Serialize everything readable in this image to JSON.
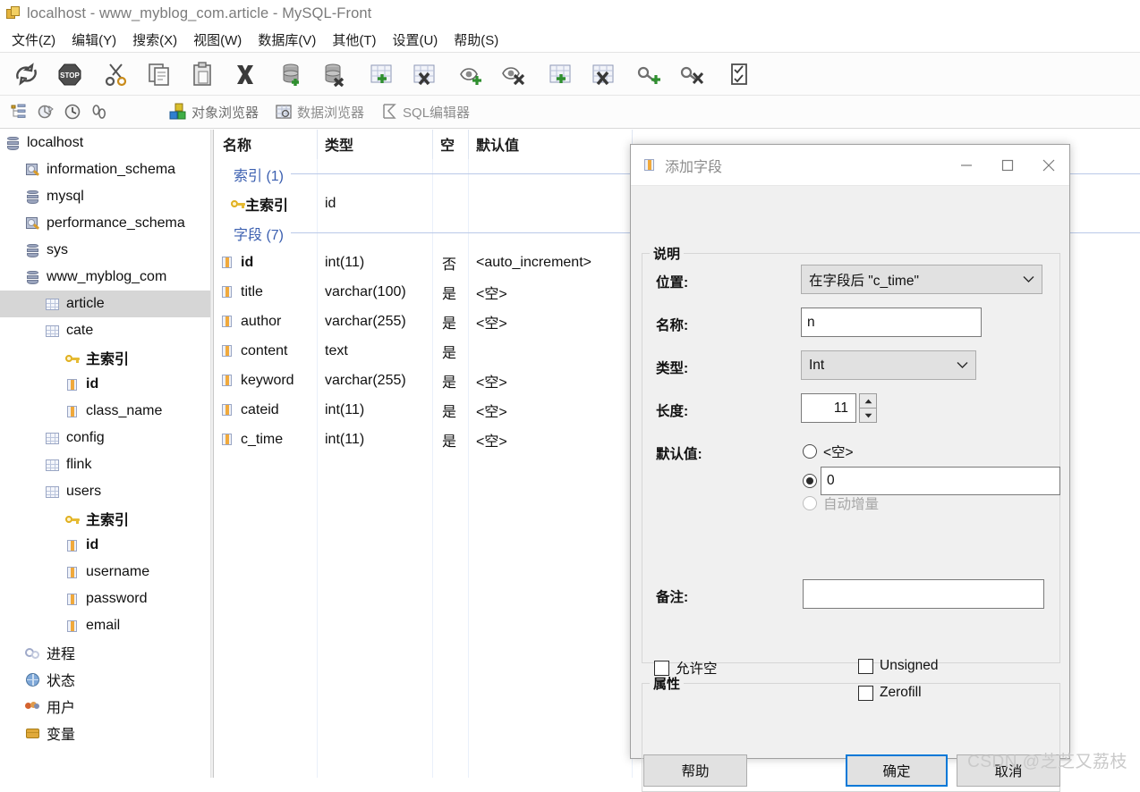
{
  "window": {
    "title": "localhost - www_myblog_com.article - MySQL-Front",
    "app_icon": "mysql-front-icon"
  },
  "menu": {
    "items": [
      {
        "label": "文件(Z)",
        "name": "menu-file"
      },
      {
        "label": "编辑(Y)",
        "name": "menu-edit"
      },
      {
        "label": "搜索(X)",
        "name": "menu-search"
      },
      {
        "label": "视图(W)",
        "name": "menu-view"
      },
      {
        "label": "数据库(V)",
        "name": "menu-database"
      },
      {
        "label": "其他(T)",
        "name": "menu-other"
      },
      {
        "label": "设置(U)",
        "name": "menu-settings"
      },
      {
        "label": "帮助(S)",
        "name": "menu-help"
      }
    ]
  },
  "toolbar": {
    "buttons": [
      "refresh-icon",
      "stop-icon",
      "cut-icon",
      "copy-icon",
      "paste-icon",
      "delete-icon",
      "add-database-icon",
      "drop-database-icon",
      "add-table-icon",
      "drop-table-icon",
      "add-view-icon",
      "drop-view-icon",
      "add-field-icon",
      "drop-field-icon",
      "add-index-icon",
      "drop-index-icon",
      "check-table-icon"
    ]
  },
  "toolbar2": {
    "small_buttons": [
      "tree-icon",
      "structure-icon",
      "history-icon",
      "steps-icon"
    ],
    "tabs": [
      {
        "label": "对象浏览器",
        "icon": "object-browser-icon",
        "active": true
      },
      {
        "label": "数据浏览器",
        "icon": "data-browser-icon",
        "active": false
      },
      {
        "label": "SQL编辑器",
        "icon": "sql-editor-icon",
        "active": false
      }
    ]
  },
  "sidebar": {
    "nodes": [
      {
        "label": "localhost",
        "icon": "server-icon",
        "indent": 0,
        "selected": false,
        "bold": false
      },
      {
        "label": "information_schema",
        "icon": "schema-icon",
        "indent": 1,
        "selected": false,
        "bold": false
      },
      {
        "label": "mysql",
        "icon": "database-icon",
        "indent": 1,
        "selected": false,
        "bold": false
      },
      {
        "label": "performance_schema",
        "icon": "schema-icon",
        "indent": 1,
        "selected": false,
        "bold": false
      },
      {
        "label": "sys",
        "icon": "database-icon",
        "indent": 1,
        "selected": false,
        "bold": false
      },
      {
        "label": "www_myblog_com",
        "icon": "database-icon",
        "indent": 1,
        "selected": false,
        "bold": false
      },
      {
        "label": "article",
        "icon": "table-icon",
        "indent": 2,
        "selected": true,
        "bold": false
      },
      {
        "label": "cate",
        "icon": "table-icon",
        "indent": 2,
        "selected": false,
        "bold": false
      },
      {
        "label": "主索引",
        "icon": "key-icon",
        "indent": 3,
        "selected": false,
        "bold": true
      },
      {
        "label": "id",
        "icon": "field-icon",
        "indent": 3,
        "selected": false,
        "bold": true
      },
      {
        "label": "class_name",
        "icon": "field-icon",
        "indent": 3,
        "selected": false,
        "bold": false
      },
      {
        "label": "config",
        "icon": "table-icon",
        "indent": 2,
        "selected": false,
        "bold": false
      },
      {
        "label": "flink",
        "icon": "table-icon",
        "indent": 2,
        "selected": false,
        "bold": false
      },
      {
        "label": "users",
        "icon": "table-icon",
        "indent": 2,
        "selected": false,
        "bold": false
      },
      {
        "label": "主索引",
        "icon": "key-icon",
        "indent": 3,
        "selected": false,
        "bold": true
      },
      {
        "label": "id",
        "icon": "field-icon",
        "indent": 3,
        "selected": false,
        "bold": true
      },
      {
        "label": "username",
        "icon": "field-icon",
        "indent": 3,
        "selected": false,
        "bold": false
      },
      {
        "label": "password",
        "icon": "field-icon",
        "indent": 3,
        "selected": false,
        "bold": false
      },
      {
        "label": "email",
        "icon": "field-icon",
        "indent": 3,
        "selected": false,
        "bold": false
      },
      {
        "label": "进程",
        "icon": "process-icon",
        "indent": 1,
        "selected": false,
        "bold": false
      },
      {
        "label": "状态",
        "icon": "status-icon",
        "indent": 1,
        "selected": false,
        "bold": false
      },
      {
        "label": "用户",
        "icon": "users-icon",
        "indent": 1,
        "selected": false,
        "bold": false
      },
      {
        "label": "变量",
        "icon": "variables-icon",
        "indent": 1,
        "selected": false,
        "bold": false
      }
    ]
  },
  "grid": {
    "columns": [
      "名称",
      "类型",
      "空",
      "默认值"
    ],
    "sections": [
      {
        "label": "索引 (1)"
      },
      {
        "label": "字段 (7)"
      }
    ],
    "index_rows": [
      {
        "name": "主索引",
        "type": "id",
        "null": "",
        "default": "",
        "icon": "key-icon"
      }
    ],
    "field_rows": [
      {
        "name": "id",
        "type": "int(11)",
        "null": "否",
        "default": "<auto_increment>",
        "bold": true
      },
      {
        "name": "title",
        "type": "varchar(100)",
        "null": "是",
        "default": "<空>",
        "bold": false
      },
      {
        "name": "author",
        "type": "varchar(255)",
        "null": "是",
        "default": "<空>",
        "bold": false
      },
      {
        "name": "content",
        "type": "text",
        "null": "是",
        "default": "",
        "bold": false
      },
      {
        "name": "keyword",
        "type": "varchar(255)",
        "null": "是",
        "default": "<空>",
        "bold": false
      },
      {
        "name": "cateid",
        "type": "int(11)",
        "null": "是",
        "default": "<空>",
        "bold": false
      },
      {
        "name": "c_time",
        "type": "int(11)",
        "null": "是",
        "default": "<空>",
        "bold": false
      }
    ]
  },
  "dialog": {
    "title": "添加字段",
    "icon": "field-icon",
    "min_label": "—",
    "max_label": "□",
    "close_label": "✕",
    "description_group": {
      "title": "说明",
      "position_label": "位置:",
      "position_value": "在字段后 \"c_time\"",
      "name_label": "名称:",
      "name_value": "n",
      "name_placeholder": "",
      "type_label": "类型:",
      "type_value": "Int",
      "length_label": "长度:",
      "length_value": "11",
      "default_label": "默认值:",
      "default_options": [
        {
          "label": "<空>",
          "selected": false,
          "disabled": false
        },
        {
          "label": "",
          "selected": true,
          "disabled": false,
          "is_text": true,
          "value": "0"
        },
        {
          "label": "自动增量",
          "selected": false,
          "disabled": true
        }
      ],
      "comment_label": "备注:",
      "comment_value": ""
    },
    "attributes_group": {
      "title": "属性",
      "checkboxes": [
        {
          "label": "允许空",
          "checked": false,
          "name": "allow-null-checkbox"
        },
        {
          "label": "Unsigned",
          "checked": false,
          "name": "unsigned-checkbox"
        },
        {
          "label": "Zerofill",
          "checked": false,
          "name": "zerofill-checkbox"
        }
      ]
    },
    "buttons": {
      "help": "帮助",
      "ok": "确定",
      "cancel": "取消"
    }
  },
  "watermark": "CSDN @芝芝又荔枝"
}
